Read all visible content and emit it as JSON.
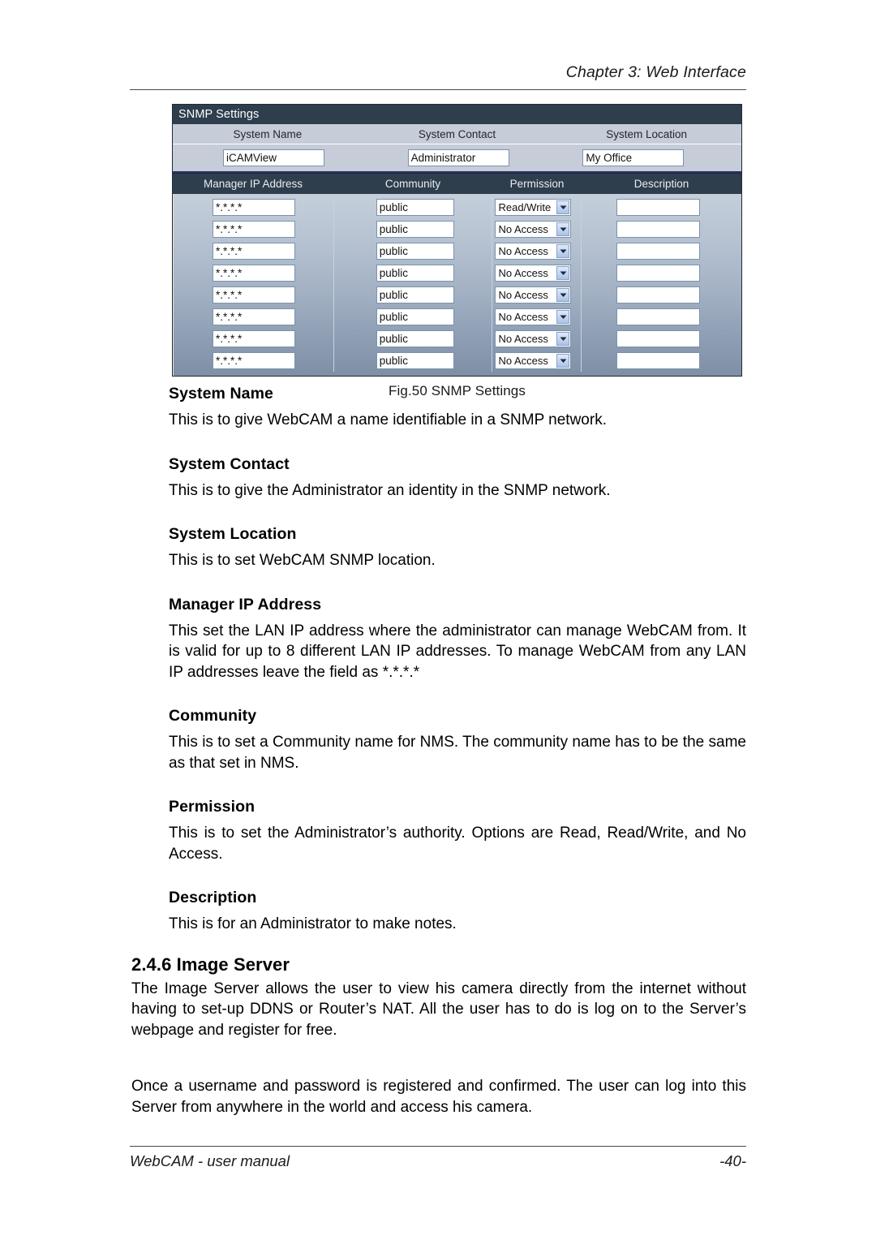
{
  "header": {
    "chapter": "Chapter 3: Web Interface"
  },
  "figure": {
    "panel_title": "SNMP Settings",
    "caption": "Fig.50  SNMP Settings",
    "top_form": {
      "labels": {
        "system_name": "System Name",
        "system_contact": "System Contact",
        "system_location": "System Location"
      },
      "values": {
        "system_name": "iCAMView",
        "system_contact": "Administrator",
        "system_location": "My Office"
      }
    },
    "manager_table": {
      "columns": [
        "Manager IP Address",
        "Community",
        "Permission",
        "Description"
      ],
      "rows": [
        {
          "ip": "*.*.*.*",
          "community": "public",
          "permission": "Read/Write",
          "description": ""
        },
        {
          "ip": "*.*.*.*",
          "community": "public",
          "permission": "No Access",
          "description": ""
        },
        {
          "ip": "*.*.*.*",
          "community": "public",
          "permission": "No Access",
          "description": ""
        },
        {
          "ip": "*.*.*.*",
          "community": "public",
          "permission": "No Access",
          "description": ""
        },
        {
          "ip": "*.*.*.*",
          "community": "public",
          "permission": "No Access",
          "description": ""
        },
        {
          "ip": "*.*.*.*",
          "community": "public",
          "permission": "No Access",
          "description": ""
        },
        {
          "ip": "*.*.*.*",
          "community": "public",
          "permission": "No Access",
          "description": ""
        },
        {
          "ip": "*.*.*.*",
          "community": "public",
          "permission": "No Access",
          "description": ""
        }
      ],
      "permission_options": [
        "Read",
        "Read/Write",
        "No Access"
      ]
    },
    "colors": {
      "titlebar": "#2e3e4d",
      "header_row": "#2e3e4d",
      "form_bg": "#c6ccd8",
      "body_gradient_top": "#c5cfdb",
      "body_gradient_bottom": "#7f8fa6",
      "input_border": "#7a93ab"
    }
  },
  "sections": [
    {
      "heading": "System Name",
      "body": "This is to give WebCAM a name identifiable in a SNMP network."
    },
    {
      "heading": "System Contact",
      "body": "This is to give the Administrator an identity in the SNMP network."
    },
    {
      "heading": "System Location",
      "body": "This is to set WebCAM SNMP location."
    },
    {
      "heading": "Manager IP Address",
      "body": "This set the LAN IP address where the administrator can manage WebCAM from.   It is valid for up to 8 different LAN IP addresses.   To manage WebCAM from any LAN IP addresses leave the field as *.*.*.*"
    },
    {
      "heading": "Community",
      "body": "This is to set a Community name for NMS. The community name has to be the same as that set in NMS."
    },
    {
      "heading": "Permission",
      "body": "This is to set the Administrator’s authority.   Options are Read, Read/Write, and No Access."
    },
    {
      "heading": "Description",
      "body": "This is for an Administrator to make notes."
    }
  ],
  "image_server": {
    "heading": "2.4.6 Image Server",
    "paragraph_1": "The Image Server allows the user to view his camera directly from the internet without having to set-up DDNS or Router’s NAT.   All the user has to do is log on to the Server’s webpage and register for free.",
    "paragraph_2": "Once a username and password is registered and confirmed.   The user can log into this Server from anywhere in the world and access his camera."
  },
  "footer": {
    "left": "WebCAM - user manual",
    "right": "-40-"
  }
}
